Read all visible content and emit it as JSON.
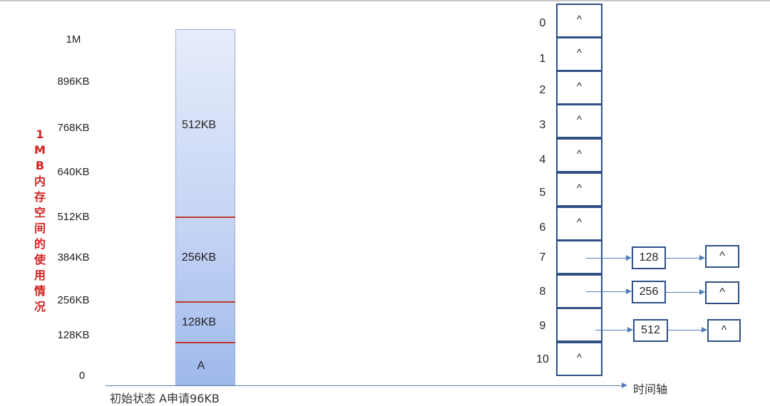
{
  "memory_diagram": {
    "side_title": "1MB内存空间的使用情况",
    "y_labels": [
      "1M",
      "896KB",
      "768KB",
      "640KB",
      "512KB",
      "384KB",
      "256KB",
      "128KB",
      "0"
    ],
    "blocks": [
      {
        "label": "512KB",
        "size_kb": 512
      },
      {
        "label": "256KB",
        "size_kb": 256
      },
      {
        "label": "128KB",
        "size_kb": 128
      },
      {
        "label": "A",
        "size_kb": 128
      }
    ],
    "bottom_caption": "初始状态 A申请96KB",
    "time_axis_label": "时间轴"
  },
  "free_list": {
    "indices": [
      "0",
      "1",
      "2",
      "3",
      "4",
      "5",
      "6",
      "7",
      "8",
      "9",
      "10"
    ],
    "empty_marker": "^",
    "cells": [
      "^",
      "^",
      "^",
      "^",
      "^",
      "^",
      "^",
      "",
      "",
      "",
      "^"
    ],
    "nodes": [
      {
        "index": "7",
        "value": "128",
        "next": "^"
      },
      {
        "index": "8",
        "value": "256",
        "next": "^"
      },
      {
        "index": "9",
        "value": "512",
        "next": "^"
      }
    ]
  }
}
